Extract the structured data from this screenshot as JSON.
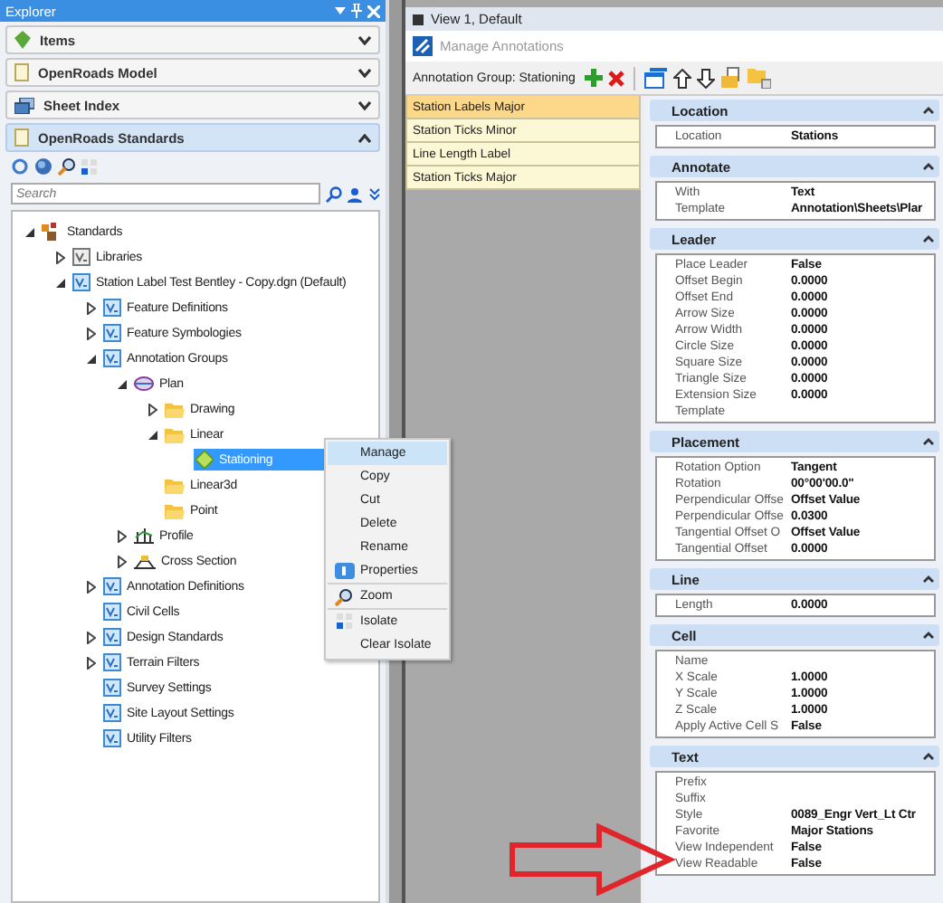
{
  "explorer": {
    "title": "Explorer",
    "sections": [
      {
        "label": "Items",
        "expanded": false
      },
      {
        "label": "OpenRoads Model",
        "expanded": false
      },
      {
        "label": "Sheet Index",
        "expanded": false
      },
      {
        "label": "OpenRoads Standards",
        "expanded": true
      }
    ],
    "search": {
      "placeholder": "Search"
    },
    "tree": [
      {
        "label": "Standards",
        "kind": "standards",
        "expanded": true,
        "selected": false,
        "children": [
          {
            "label": "Libraries",
            "kind": "library",
            "expanded": false,
            "selected": false
          },
          {
            "label": "Station Label Test Bentley - Copy.dgn (Default)",
            "kind": "dgn",
            "expanded": true,
            "selected": false,
            "children": [
              {
                "label": "Feature Definitions",
                "kind": "dgn",
                "expanded": false,
                "selected": false
              },
              {
                "label": "Feature Symbologies",
                "kind": "dgn",
                "expanded": false,
                "selected": false
              },
              {
                "label": "Annotation Groups",
                "kind": "dgn",
                "expanded": true,
                "selected": false,
                "children": [
                  {
                    "label": "Plan",
                    "kind": "plan",
                    "expanded": true,
                    "selected": false,
                    "children": [
                      {
                        "label": "Drawing",
                        "kind": "folder",
                        "expanded": false,
                        "selected": false
                      },
                      {
                        "label": "Linear",
                        "kind": "folder",
                        "expanded": true,
                        "selected": false,
                        "children": [
                          {
                            "label": "Stationing",
                            "kind": "stationing",
                            "selected": true
                          }
                        ]
                      },
                      {
                        "label": "Linear3d",
                        "kind": "folder",
                        "selected": false
                      },
                      {
                        "label": "Point",
                        "kind": "folder",
                        "selected": false
                      }
                    ]
                  },
                  {
                    "label": "Profile",
                    "kind": "profile",
                    "expanded": false,
                    "selected": false
                  },
                  {
                    "label": "Cross Section",
                    "kind": "cross-section",
                    "expanded": false,
                    "selected": false
                  }
                ]
              },
              {
                "label": "Annotation Definitions",
                "kind": "dgn",
                "expanded": false,
                "selected": false
              },
              {
                "label": "Civil Cells",
                "kind": "dgn",
                "selected": false
              },
              {
                "label": "Design Standards",
                "kind": "dgn",
                "expanded": false,
                "selected": false
              },
              {
                "label": "Terrain Filters",
                "kind": "dgn",
                "expanded": false,
                "selected": false
              },
              {
                "label": "Survey Settings",
                "kind": "dgn",
                "selected": false
              },
              {
                "label": "Site Layout Settings",
                "kind": "dgn",
                "selected": false
              },
              {
                "label": "Utility Filters",
                "kind": "dgn",
                "selected": false
              }
            ]
          }
        ]
      }
    ]
  },
  "context_menu": {
    "groups": [
      [
        {
          "label": "Manage",
          "kind": "plain",
          "selected": true
        },
        {
          "label": "Copy",
          "kind": "plain",
          "selected": false
        },
        {
          "label": "Cut",
          "kind": "plain",
          "selected": false
        },
        {
          "label": "Delete",
          "kind": "plain",
          "selected": false
        },
        {
          "label": "Rename",
          "kind": "plain",
          "selected": false
        },
        {
          "label": "Properties",
          "kind": "properties",
          "selected": false
        }
      ],
      [
        {
          "label": "Zoom",
          "kind": "zoom",
          "selected": false
        }
      ],
      [
        {
          "label": "Isolate",
          "kind": "isolate",
          "selected": false
        },
        {
          "label": "Clear Isolate",
          "kind": "plain",
          "selected": false
        }
      ]
    ]
  },
  "view_window": {
    "title": "View 1, Default"
  },
  "dialog": {
    "title": "Manage Annotations",
    "group_label": "Annotation Group: Stationing",
    "annotations": [
      {
        "label": "Station Labels Major",
        "selected": true
      },
      {
        "label": "Station Ticks Minor",
        "selected": false
      },
      {
        "label": "Line Length Label",
        "selected": false
      },
      {
        "label": "Station Ticks Major",
        "selected": false
      }
    ],
    "properties": [
      {
        "title": "Location",
        "expanded": true,
        "rows": [
          {
            "name": "Location",
            "value": "Stations"
          }
        ]
      },
      {
        "title": "Annotate",
        "expanded": true,
        "rows": [
          {
            "name": "With",
            "value": "Text"
          },
          {
            "name": "Template",
            "value": "Annotation\\Sheets\\Plar"
          }
        ]
      },
      {
        "title": "Leader",
        "expanded": true,
        "rows": [
          {
            "name": "Place Leader",
            "value": "False"
          },
          {
            "name": "Offset Begin",
            "value": "0.0000"
          },
          {
            "name": "Offset End",
            "value": "0.0000"
          },
          {
            "name": "Arrow Size",
            "value": "0.0000"
          },
          {
            "name": "Arrow Width",
            "value": "0.0000"
          },
          {
            "name": "Circle Size",
            "value": "0.0000"
          },
          {
            "name": "Square Size",
            "value": "0.0000"
          },
          {
            "name": "Triangle Size",
            "value": "0.0000"
          },
          {
            "name": "Extension Size",
            "value": "0.0000"
          },
          {
            "name": "Template"
          }
        ]
      },
      {
        "title": "Placement",
        "expanded": true,
        "rows": [
          {
            "name": "Rotation Option",
            "value": "Tangent"
          },
          {
            "name": "Rotation",
            "value": "00°00'00.0\""
          },
          {
            "name": "Perpendicular Offse",
            "value": "Offset Value"
          },
          {
            "name": "Perpendicular Offse",
            "value": "0.0300"
          },
          {
            "name": "Tangential Offset O",
            "value": "Offset Value"
          },
          {
            "name": "Tangential Offset",
            "value": "0.0000"
          }
        ]
      },
      {
        "title": "Line",
        "expanded": true,
        "rows": [
          {
            "name": "Length",
            "value": "0.0000"
          }
        ]
      },
      {
        "title": "Cell",
        "expanded": true,
        "rows": [
          {
            "name": "Name"
          },
          {
            "name": "X Scale",
            "value": "1.0000"
          },
          {
            "name": "Y Scale",
            "value": "1.0000"
          },
          {
            "name": "Z Scale",
            "value": "1.0000"
          },
          {
            "name": "Apply Active Cell S",
            "value": "False"
          }
        ]
      },
      {
        "title": "Text",
        "expanded": true,
        "rows": [
          {
            "name": "Prefix"
          },
          {
            "name": "Suffix"
          },
          {
            "name": "Style",
            "value": "0089_Engr Vert_Lt Ctr"
          },
          {
            "name": "Favorite",
            "value": "Major Stations"
          },
          {
            "name": "View Independent",
            "value": "False"
          },
          {
            "name": "View Readable",
            "value": "False"
          }
        ]
      }
    ]
  }
}
